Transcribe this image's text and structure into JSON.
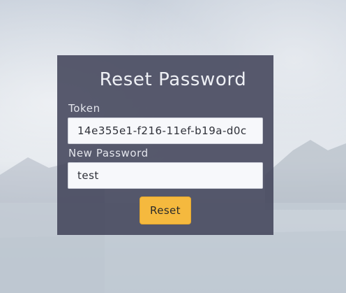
{
  "form": {
    "title": "Reset Password",
    "token_label": "Token",
    "token_value": "14e355e1-f216-11ef-b19a-d0c",
    "new_password_label": "New Password",
    "new_password_value": "test",
    "reset_button_label": "Reset"
  },
  "colors": {
    "card_background": "#42445a",
    "button_accent": "#f5b93e"
  }
}
